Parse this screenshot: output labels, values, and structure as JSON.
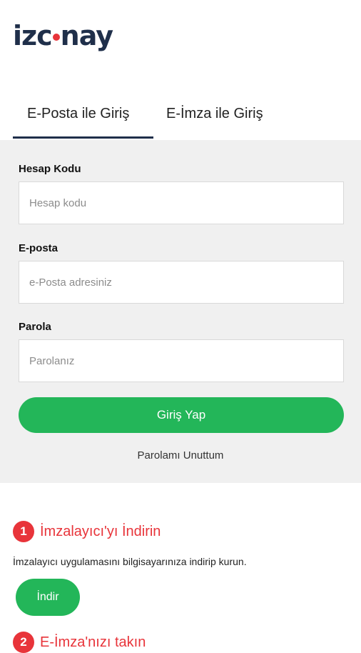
{
  "brand": {
    "logo_left": "izc",
    "logo_right": "nay",
    "accent_color": "#e8343a",
    "primary_color": "#1f2f4a",
    "button_color": "#23b659"
  },
  "tabs": [
    {
      "label": "E-Posta ile Giriş",
      "active": true
    },
    {
      "label": "E-İmza ile Giriş",
      "active": false
    }
  ],
  "form": {
    "account_code_label": "Hesap Kodu",
    "account_code_placeholder": "Hesap kodu",
    "email_label": "E-posta",
    "email_placeholder": "e-Posta adresiniz",
    "password_label": "Parola",
    "password_placeholder": "Parolanız",
    "submit_label": "Giriş Yap",
    "forgot_label": "Parolamı Unuttum"
  },
  "steps": [
    {
      "number": "1",
      "title": "İmzalayıcı'yı İndirin",
      "description": "İmzalayıcı uygulamasını bilgisayarınıza indirip kurun.",
      "button_label": "İndir"
    },
    {
      "number": "2",
      "title": "E-İmza'nızı takın"
    }
  ]
}
